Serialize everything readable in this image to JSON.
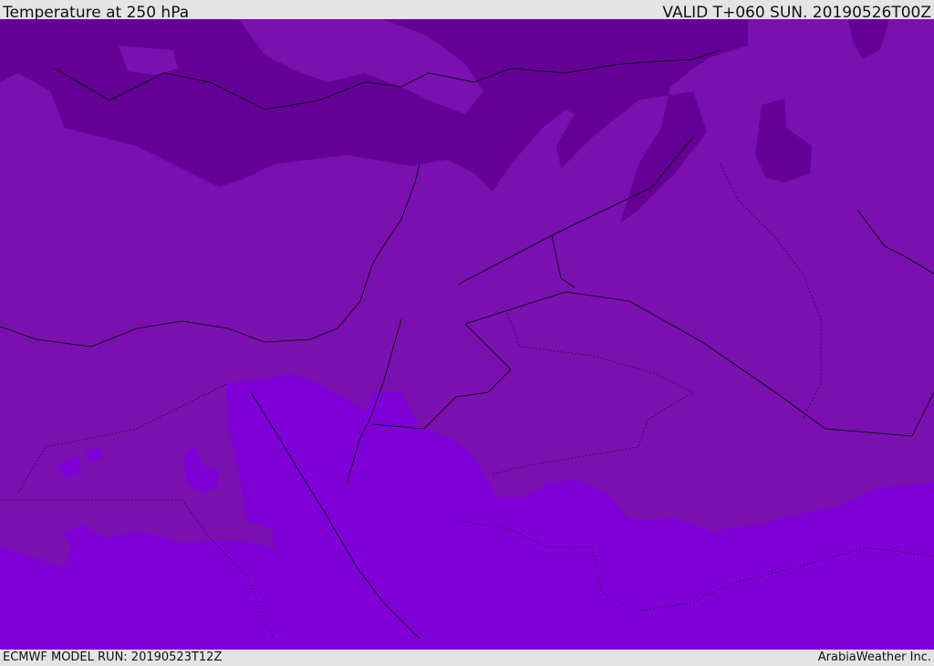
{
  "header": {
    "title": "Temperature at 250 hPa",
    "valid": "VALID T+060 SUN. 20190526T00Z"
  },
  "footer": {
    "model_run": "ECMWF MODEL RUN: 20190523T12Z",
    "credit": "ArabiaWeather Inc."
  },
  "colors": {
    "cold": "#650096",
    "mid": "#7a10b0",
    "warm": "#8000d8",
    "border": "#000000"
  }
}
